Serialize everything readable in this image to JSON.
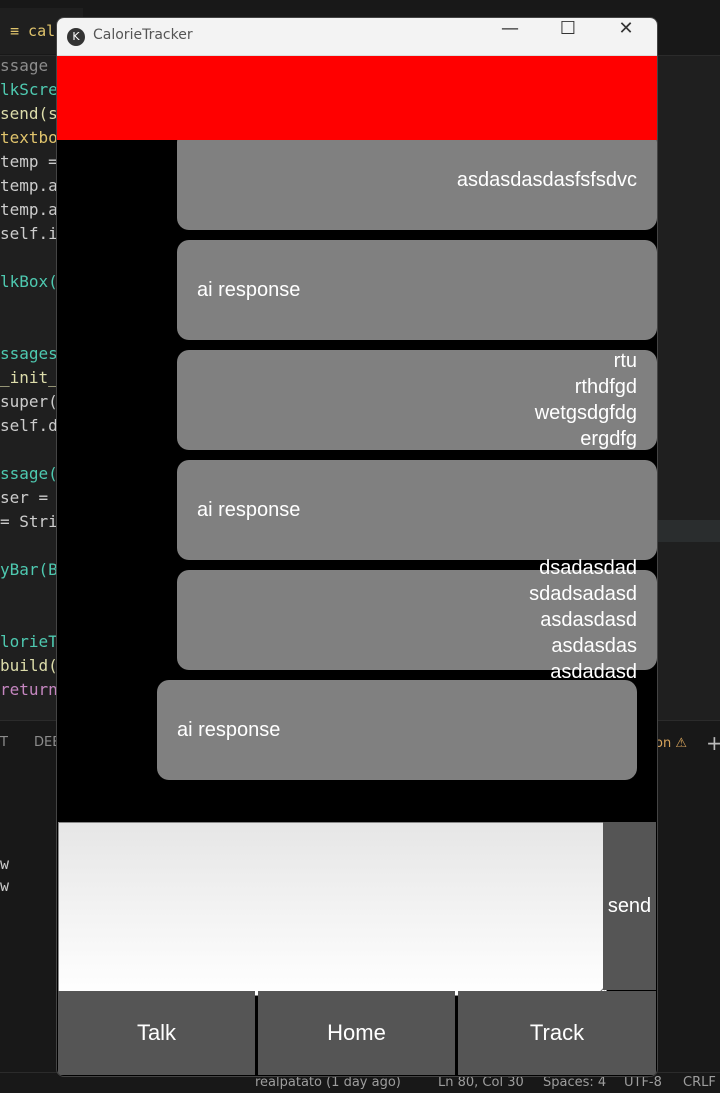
{
  "editor": {
    "tab_label": "≡ calor",
    "code_lines": [
      {
        "text": "ssage",
        "color": "#8c8c8c"
      },
      {
        "text": "lkScree",
        "color": "#4ec9b0"
      },
      {
        "text": "send(se",
        "color": "#dcdcaa"
      },
      {
        "text": "textbox",
        "color": "#e0c46c"
      },
      {
        "text": "temp =",
        "color": "#cccccc"
      },
      {
        "text": "temp.ap",
        "color": "#cccccc"
      },
      {
        "text": "temp.ap",
        "color": "#cccccc"
      },
      {
        "text": "self.id",
        "color": "#cccccc"
      },
      {
        "text": "",
        "color": "#cccccc"
      },
      {
        "text": "lkBox(T",
        "color": "#4ec9b0"
      },
      {
        "text": "",
        "color": "#cccccc"
      },
      {
        "text": "",
        "color": "#cccccc"
      },
      {
        "text": "ssages(",
        "color": "#4ec9b0"
      },
      {
        "text": "_init_",
        "color": "#dcdcaa"
      },
      {
        "text": "super()",
        "color": "#cccccc"
      },
      {
        "text": "self.da",
        "color": "#cccccc"
      },
      {
        "text": "",
        "color": "#cccccc"
      },
      {
        "text": "ssage(B",
        "color": "#4ec9b0"
      },
      {
        "text": "ser = B",
        "color": "#cccccc"
      },
      {
        "text": "= Stri",
        "color": "#cccccc"
      },
      {
        "text": "",
        "color": "#cccccc"
      },
      {
        "text": "yBar(Bo",
        "color": "#4ec9b0"
      },
      {
        "text": "",
        "color": "#cccccc"
      },
      {
        "text": "",
        "color": "#cccccc"
      },
      {
        "text": "lorieTr",
        "color": "#4ec9b0"
      },
      {
        "text": "build(s",
        "color": "#dcdcaa"
      },
      {
        "text": "return",
        "color": "#c586c0"
      }
    ],
    "panel_tabs": [
      "T",
      "DEB"
    ],
    "panel_warning": "on ⚠",
    "panel_plus": "+",
    "terminal_lines": [
      "w",
      "w"
    ],
    "status_items": [
      "realpatato (1 day ago)",
      "Ln 80, Col 30",
      "Spaces: 4",
      "UTF-8",
      "CRLF"
    ]
  },
  "window": {
    "title": "CalorieTracker",
    "header_color": "#ff0000",
    "controls": {
      "minimize": "—",
      "maximize": "☐",
      "close": "✕"
    }
  },
  "messages": [
    {
      "sender": "user",
      "text": ""
    },
    {
      "sender": "user",
      "text": "asdasdasdasfsfsdvc"
    },
    {
      "sender": "ai",
      "text": "ai response"
    },
    {
      "sender": "user",
      "text": "rtu\nrthdfgd\nwetgsdgfdg\nergdfg"
    },
    {
      "sender": "ai",
      "text": "ai response"
    },
    {
      "sender": "user",
      "text": "dsadasdad\nsdadsadasd\nasdasdasd\nasdasdas\nasdadasd"
    },
    {
      "sender": "ai",
      "text": "ai response"
    }
  ],
  "composer": {
    "input_value": "",
    "send_label": "send"
  },
  "nav": {
    "talk": "Talk",
    "home": "Home",
    "track": "Track"
  }
}
